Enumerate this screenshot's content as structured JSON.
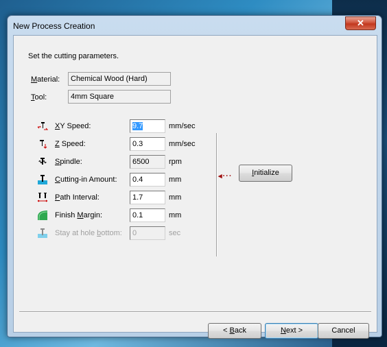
{
  "window": {
    "title": "New Process Creation",
    "close_glyph": "✕"
  },
  "instruction": "Set the cutting parameters.",
  "material": {
    "label_u": "M",
    "label_rest": "aterial:",
    "value": "Chemical Wood (Hard)"
  },
  "tool": {
    "label_u": "T",
    "label_rest": "ool:",
    "value": "4mm Square"
  },
  "params": [
    {
      "icon": "xy-speed-icon",
      "label_u": "X",
      "label_rest": "Y Speed:",
      "value": "9.7",
      "unit": "mm/sec"
    },
    {
      "icon": "z-speed-icon",
      "label_u": "Z",
      "label_rest": " Speed:",
      "value": "0.3",
      "unit": "mm/sec"
    },
    {
      "icon": "spindle-icon",
      "label_u": "S",
      "label_rest": "pindle:",
      "value": "6500",
      "unit": "rpm"
    },
    {
      "icon": "cutting-in-icon",
      "label_u": "C",
      "label_rest": "utting-in Amount:",
      "value": "0.4",
      "unit": "mm"
    },
    {
      "icon": "path-interval-icon",
      "label_u": "P",
      "label_rest": "ath Interval:",
      "value": "1.7",
      "unit": "mm"
    },
    {
      "icon": "finish-margin-icon",
      "label_pre": "Finish ",
      "label_u": "M",
      "label_rest": "argin:",
      "value": "0.1",
      "unit": "mm"
    },
    {
      "icon": "stay-hole-icon",
      "label_pre": "Stay at hole ",
      "label_u": "b",
      "label_rest": "ottom:",
      "value": "0",
      "unit": "sec"
    }
  ],
  "initialize": {
    "label_u": "I",
    "label_rest": "nitialize",
    "arrow": "◂···"
  },
  "buttons": {
    "back_u": "B",
    "back_pre": "< ",
    "back_rest": "ack",
    "next_u": "N",
    "next_rest": "ext >",
    "cancel": "Cancel"
  }
}
